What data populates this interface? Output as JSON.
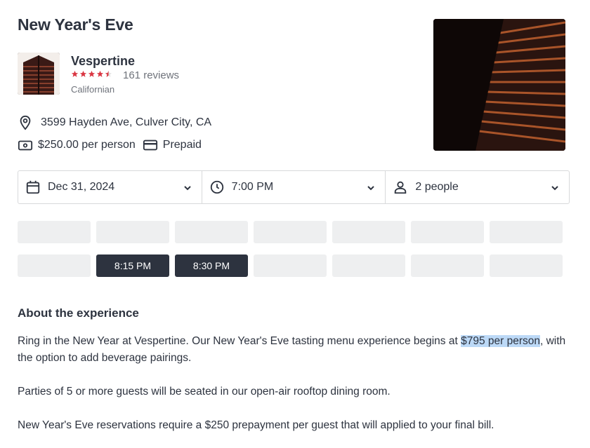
{
  "experience": {
    "title": "New Year's Eve"
  },
  "restaurant": {
    "name": "Vespertine",
    "rating": 4.5,
    "reviews": "161 reviews",
    "cuisine": "Californian",
    "thumbnail_icon": "building-facade-photo"
  },
  "details": {
    "address": "3599 Hayden Ave, Culver City, CA",
    "price": "$250.00 per person",
    "payment": "Prepaid"
  },
  "pickers": {
    "date": "Dec 31, 2024",
    "time": "7:00 PM",
    "party": "2 people"
  },
  "slots": {
    "row1": [
      "",
      "",
      "",
      "",
      "",
      "",
      ""
    ],
    "row2": [
      "",
      "8:15 PM",
      "8:30 PM",
      "",
      "",
      "",
      ""
    ]
  },
  "about": {
    "heading": "About the experience",
    "p1_before": "Ring in the New Year at Vespertine. Our New Year's Eve tasting menu experience begins at ",
    "p1_highlight": "$795 per person",
    "p1_after": ", with the option to add beverage pairings.",
    "p2": "Parties of 5 or more guests will be seated in our open-air rooftop dining room.",
    "p3": "New Year's Eve reservations require a $250 prepayment per guest that will applied to your final bill."
  },
  "colors": {
    "star": "#da3743",
    "dark_slot": "#2d333f",
    "empty_slot": "#eeeff0",
    "highlight": "#bcd9f7"
  }
}
